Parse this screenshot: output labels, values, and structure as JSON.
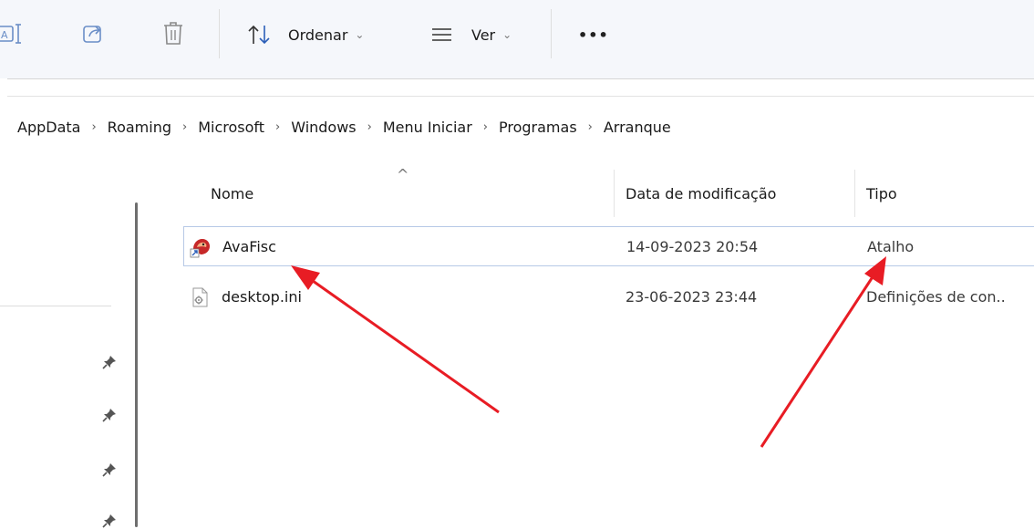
{
  "toolbar": {
    "sort_label": "Ordenar",
    "view_label": "Ver",
    "more_label": "•••"
  },
  "breadcrumb": [
    "AppData",
    "Roaming",
    "Microsoft",
    "Windows",
    "Menu Iniciar",
    "Programas",
    "Arranque"
  ],
  "breadcrumb_separator": "›",
  "columns": {
    "name": "Nome",
    "date": "Data de modificação",
    "type": "Tipo",
    "sort_indicator": "^"
  },
  "files": [
    {
      "name": "AvaFisc",
      "date": "14-09-2023 20:54",
      "type": "Atalho",
      "icon": "shortcut-app-icon",
      "selected": true
    },
    {
      "name": "desktop.ini",
      "date": "23-06-2023 23:44",
      "type": "Definições de con..",
      "icon": "settings-file-icon",
      "selected": false
    }
  ],
  "colors": {
    "accent": "#2c5fb8",
    "annotation_arrow": "#e81c24",
    "selection_border": "#b7c9e6"
  }
}
